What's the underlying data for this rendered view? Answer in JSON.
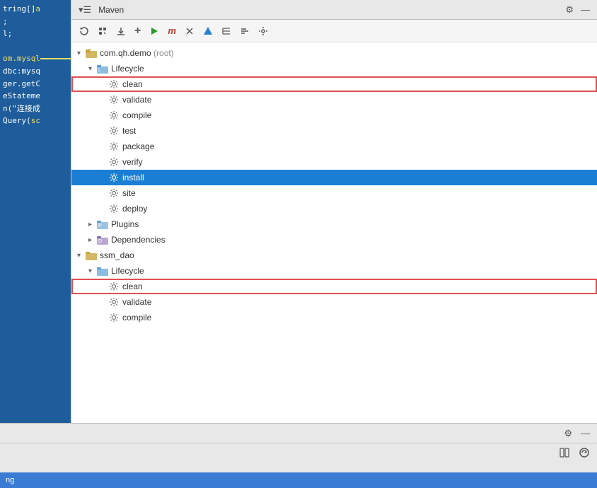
{
  "panel": {
    "title": "Maven",
    "toolbar": {
      "buttons": [
        {
          "name": "refresh",
          "icon": "↺",
          "label": "Refresh"
        },
        {
          "name": "collapse",
          "icon": "⊟",
          "label": "Collapse"
        },
        {
          "name": "download",
          "icon": "⬇",
          "label": "Download Sources"
        },
        {
          "name": "add",
          "icon": "+",
          "label": "Add"
        },
        {
          "name": "run",
          "icon": "▶",
          "label": "Run"
        },
        {
          "name": "maven",
          "icon": "m",
          "label": "Maven"
        },
        {
          "name": "skip-test",
          "icon": "⊘",
          "label": "Skip Tests"
        },
        {
          "name": "lightning",
          "icon": "⚡",
          "label": "Toggle Offline"
        },
        {
          "name": "tree",
          "icon": "≡",
          "label": "Tree"
        },
        {
          "name": "sort",
          "icon": "⇅",
          "label": "Sort"
        },
        {
          "name": "settings",
          "icon": "🔧",
          "label": "Settings"
        }
      ]
    },
    "tree": {
      "items": [
        {
          "id": "root1",
          "level": 1,
          "arrow": "▾",
          "icon": "folder-root",
          "label": "com.qh.demo",
          "suffix": " (root)",
          "type": "module"
        },
        {
          "id": "lifecycle1",
          "level": 2,
          "arrow": "▾",
          "icon": "lifecycle",
          "label": "Lifecycle",
          "type": "lifecycle"
        },
        {
          "id": "clean1",
          "level": 3,
          "arrow": "",
          "icon": "gear",
          "label": "clean",
          "type": "goal",
          "highlighted": true
        },
        {
          "id": "validate1",
          "level": 3,
          "arrow": "",
          "icon": "gear",
          "label": "validate",
          "type": "goal"
        },
        {
          "id": "compile1",
          "level": 3,
          "arrow": "",
          "icon": "gear",
          "label": "compile",
          "type": "goal"
        },
        {
          "id": "test1",
          "level": 3,
          "arrow": "",
          "icon": "gear",
          "label": "test",
          "type": "goal"
        },
        {
          "id": "package1",
          "level": 3,
          "arrow": "",
          "icon": "gear",
          "label": "package",
          "type": "goal"
        },
        {
          "id": "verify1",
          "level": 3,
          "arrow": "",
          "icon": "gear",
          "label": "verify",
          "type": "goal"
        },
        {
          "id": "install1",
          "level": 3,
          "arrow": "",
          "icon": "gear",
          "label": "install",
          "type": "goal",
          "selected": true
        },
        {
          "id": "site1",
          "level": 3,
          "arrow": "",
          "icon": "gear",
          "label": "site",
          "type": "goal"
        },
        {
          "id": "deploy1",
          "level": 3,
          "arrow": "",
          "icon": "gear",
          "label": "deploy",
          "type": "goal"
        },
        {
          "id": "plugins1",
          "level": 2,
          "arrow": "▸",
          "icon": "plugins",
          "label": "Plugins",
          "type": "plugins"
        },
        {
          "id": "deps1",
          "level": 2,
          "arrow": "▸",
          "icon": "dependencies",
          "label": "Dependencies",
          "type": "dependencies"
        },
        {
          "id": "root2",
          "level": 1,
          "arrow": "▾",
          "icon": "folder-root",
          "label": "ssm_dao",
          "suffix": "",
          "type": "module"
        },
        {
          "id": "lifecycle2",
          "level": 2,
          "arrow": "▾",
          "icon": "lifecycle",
          "label": "Lifecycle",
          "type": "lifecycle"
        },
        {
          "id": "clean2",
          "level": 3,
          "arrow": "",
          "icon": "gear",
          "label": "clean",
          "type": "goal",
          "highlighted": true
        },
        {
          "id": "validate2",
          "level": 3,
          "arrow": "",
          "icon": "gear",
          "label": "validate",
          "type": "goal"
        },
        {
          "id": "compile2",
          "level": 3,
          "arrow": "",
          "icon": "gear",
          "label": "compile",
          "type": "goal"
        }
      ]
    }
  },
  "code": {
    "lines": [
      "tring[]a",
      ";",
      "l;",
      "",
      "om.mysql",
      "dbc:mysq",
      "ger.getC",
      "eStateme",
      "n(\"连接成",
      "Query(sc"
    ]
  },
  "status": {
    "text": "ng"
  },
  "settings_icon": "⚙",
  "minimize_icon": "—",
  "close_icon": "✕"
}
